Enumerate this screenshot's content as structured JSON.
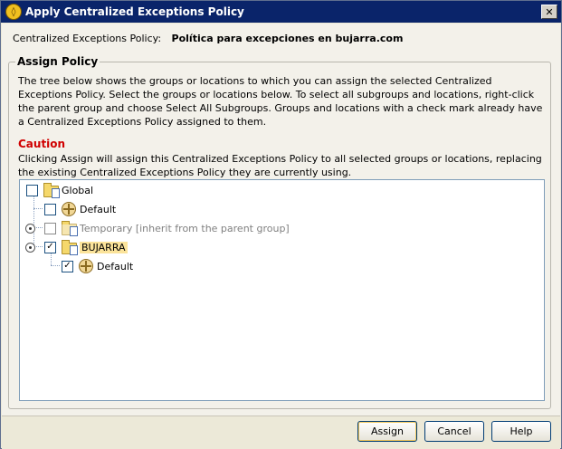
{
  "window": {
    "title": "Apply Centralized Exceptions Policy"
  },
  "policy": {
    "label": "Centralized Exceptions Policy:",
    "value": "Política para excepciones en bujarra.com"
  },
  "assign_policy": {
    "legend": "Assign Policy",
    "description": "The tree below shows the groups or locations to which you can assign the selected Centralized Exceptions Policy. Select the groups or locations below. To select all subgroups and locations, right-click the parent group and choose Select All Subgroups. Groups and locations with a check mark already have a Centralized Exceptions Policy assigned to them.",
    "caution_title": "Caution",
    "caution_text": "Clicking Assign will assign this Centralized Exceptions Policy to all selected groups or locations, replacing the existing Centralized Exceptions Policy they are currently using."
  },
  "tree": {
    "nodes": [
      {
        "label": "Global",
        "checked": false,
        "icon": "group-folder-icon"
      },
      {
        "label": "Default",
        "checked": false,
        "icon": "location-icon"
      },
      {
        "label": "Temporary [inherit from the parent group]",
        "checked": false,
        "icon": "group-folder-icon",
        "disabled": true
      },
      {
        "label": "BUJARRA",
        "checked": true,
        "icon": "group-folder-icon",
        "selected": true
      },
      {
        "label": "Default",
        "checked": true,
        "icon": "location-icon"
      }
    ]
  },
  "buttons": {
    "assign": "Assign",
    "cancel": "Cancel",
    "help": "Help"
  },
  "colors": {
    "titlebar": "#0a246a",
    "caution": "#d00000",
    "selection": "#fbe39a"
  }
}
